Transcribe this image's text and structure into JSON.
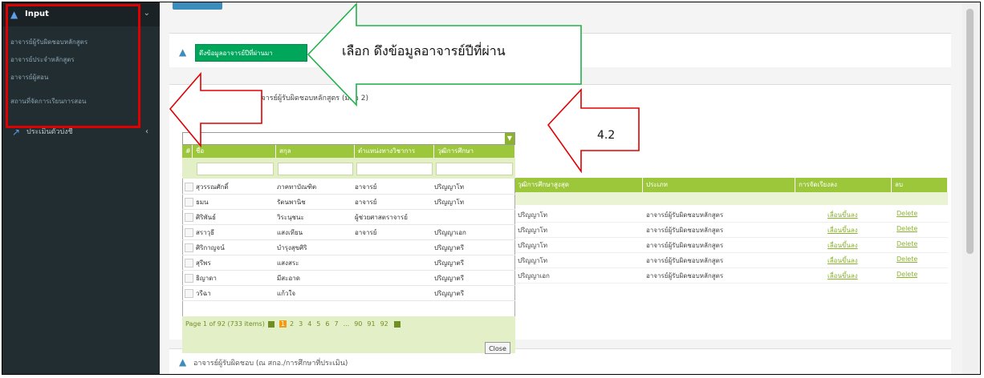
{
  "sidebar": {
    "header_label": "Input",
    "sub_items": [
      {
        "label": "อาจารย์ผู้รับผิดชอบหลักสูตร"
      },
      {
        "label": "อาจารย์ประจำหลักสูตร"
      },
      {
        "label": "อาจารย์ผู้สอน"
      },
      {
        "label": "สถานที่จัดการเรียนการสอน"
      }
    ],
    "second_item": "ประเมินตัวบ่งชี้"
  },
  "main": {
    "green_button_label": "ดึงข้อมูลอาจารย์ปีที่ผ่านมา",
    "section2_title": "อาจารย์ผู้รับผิดชอบหลักสูตร (มคอ 2)",
    "section3_title": "อาจารย์ผู้รับผิดชอบ (ณ สกอ./การศึกษาที่ประเมิน)"
  },
  "dropdown": {
    "columns": [
      "#",
      "ชื่อ",
      "สกุล",
      "ตำแหน่งทางวิชาการ",
      "วุฒิการศึกษา"
    ],
    "rows": [
      [
        "สุวรรณศักดิ์",
        "ภาคทาบัณฑิต",
        "อาจารย์",
        "ปริญญาโท"
      ],
      [
        "ธมน",
        "รัตนพานิช",
        "อาจารย์",
        "ปริญญาโท"
      ],
      [
        "ศิริพันธ์",
        "วิระนุชนะ",
        "ผู้ช่วยศาสตราจารย์",
        ""
      ],
      [
        "สราวุธี",
        "แสงเทียน",
        "อาจารย์",
        "ปริญญาเอก"
      ],
      [
        "ศิริกาญจน์",
        "บำรุงสุขศิริ",
        "",
        "ปริญญาตรี"
      ],
      [
        "สุรีพร",
        "แสงสระ",
        "",
        "ปริญญาตรี"
      ],
      [
        "ธิญาดา",
        "มีสะอาด",
        "",
        "ปริญญาตรี"
      ],
      [
        "วรีฉา",
        "แก้วใจ",
        "",
        "ปริญญาตรี"
      ]
    ],
    "pager_info": "Page 1 of 92 (733 items)",
    "pages": [
      "1",
      "2",
      "3",
      "4",
      "5",
      "6",
      "7",
      "...",
      "90",
      "91",
      "92"
    ],
    "close_label": "Close"
  },
  "right_table": {
    "headers": [
      "วุฒิการศึกษาสูงสุด",
      "ประเภท",
      "การจัดเรียงลง",
      "ลบ"
    ],
    "rows": [
      [
        "ปริญญาโท",
        "อาจารย์ผู้รับผิดชอบหลักสูตร",
        "เลื่อนขึ้นลง",
        "Delete"
      ],
      [
        "ปริญญาโท",
        "อาจารย์ผู้รับผิดชอบหลักสูตร",
        "เลื่อนขึ้นลง",
        "Delete"
      ],
      [
        "ปริญญาโท",
        "อาจารย์ผู้รับผิดชอบหลักสูตร",
        "เลื่อนขึ้นลง",
        "Delete"
      ],
      [
        "ปริญญาโท",
        "อาจารย์ผู้รับผิดชอบหลักสูตร",
        "เลื่อนขึ้นลง",
        "Delete"
      ],
      [
        "ปริญญาเอก",
        "อาจารย์ผู้รับผิดชอบหลักสูตร",
        "เลื่อนขึ้นลง",
        "Delete"
      ]
    ]
  },
  "annotations": {
    "callout_top": "เลือก ดึงข้อมูลอาจารย์ปีที่ผ่าน",
    "callout_right": "4.2",
    "colors": {
      "green_arrow": "#21b14b",
      "red_arrow": "#e00000"
    }
  },
  "colors": {
    "sidebar_bg": "#222d32",
    "grid_header": "#9dc73a",
    "button_green": "#00a65a",
    "accent_blue": "#3c8dbc"
  }
}
